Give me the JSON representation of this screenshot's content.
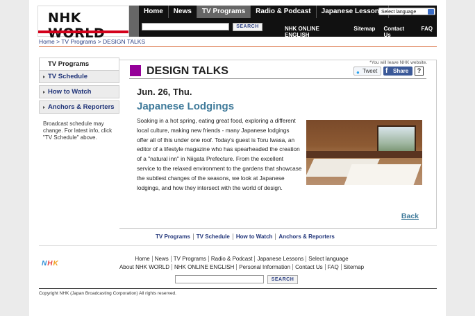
{
  "header": {
    "logo_text": "NHK WORLD",
    "nav": [
      "Home",
      "News",
      "TV Programs",
      "Radio & Podcast",
      "Japanese Lessons"
    ],
    "active_nav": "TV Programs",
    "language_select": "Select language",
    "search_button": "SEARCH",
    "sub_links": [
      "NHK ONLINE ENGLISH",
      "Sitemap",
      "Contact Us",
      "FAQ"
    ]
  },
  "breadcrumb": [
    "Home",
    "TV Programs",
    "DESIGN TALKS"
  ],
  "sidebar": {
    "title": "TV Programs",
    "items": [
      "TV Schedule",
      "How to Watch",
      "Anchors & Reporters"
    ],
    "note": "Broadcast schedule may change. For latest info, click \"TV Schedule\" above."
  },
  "main": {
    "program_title": "DESIGN TALKS",
    "leave_note": "*You will leave NHK website.",
    "tweet_label": "Tweet",
    "share_label": "Share",
    "help_label": "?",
    "date": "Jun. 26, Thu.",
    "episode_title": "Japanese Lodgings",
    "description": "Soaking in a hot spring, eating great food, exploring a different local culture, making new friends - many Japanese lodgings offer all of this under one roof. Today's guest is Toru Iwasa, an editor of a lifestyle magazine who has spearheaded the creation of a \"natural inn\" in Niigata Prefecture. From the excellent service to the relaxed environment to the gardens that showcase the subtlest changes of the seasons, we look at Japanese lodgings, and how they intersect with the world of design.",
    "back_label": "Back"
  },
  "footer": {
    "nav": [
      "TV Programs",
      "TV Schedule",
      "How to Watch",
      "Anchors & Reporters"
    ],
    "links_row1": [
      "Home",
      "News",
      "TV Programs",
      "Radio & Podcast",
      "Japanese Lessons",
      "Select language"
    ],
    "links_row2": [
      "About NHK WORLD",
      "NHK ONLINE ENGLISH",
      "Personal Information",
      "Contact Us",
      "FAQ",
      "Sitemap"
    ],
    "small_logo": "NHK",
    "search_button": "SEARCH",
    "copyright": "Copyright NHK (Japan Broadcasting Corporation) All rights reserved."
  },
  "colors": {
    "brand_red": "#d3001a",
    "program_purple": "#950099",
    "link_blue": "#1f3378",
    "title_teal": "#3f7a9a"
  }
}
